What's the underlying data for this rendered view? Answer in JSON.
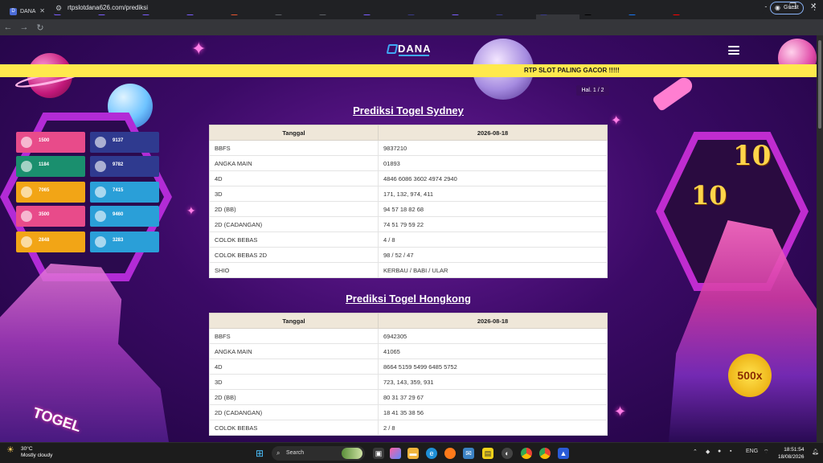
{
  "browser": {
    "tabs": [
      {
        "label": "DANA",
        "fav_color": "#4b6cd8",
        "fav": "D"
      },
      {
        "label": "DANA",
        "fav_color": "#7b5cff",
        "fav": "D"
      },
      {
        "label": "DANA",
        "fav_color": "#7b5cff",
        "fav": "D"
      },
      {
        "label": "DANA",
        "fav_color": "#7b5cff",
        "fav": "D"
      },
      {
        "label": "DANA",
        "fav_color": "#7b5cff",
        "fav": "D"
      },
      {
        "label": "Custo",
        "fav_color": "#e8542f",
        "fav": "C"
      },
      {
        "label": "DANA",
        "fav_color": "#5f6368",
        "fav": "◎"
      },
      {
        "label": "Teleg",
        "fav_color": "#5f6368",
        "fav": "◎"
      },
      {
        "label": "DANA",
        "fav_color": "#7b5cff",
        "fav": "D"
      },
      {
        "label": "RTP D",
        "fav_color": "#3a3a8a",
        "fav": "D"
      },
      {
        "label": "DANA",
        "fav_color": "#7b5cff",
        "fav": "D"
      },
      {
        "label": "Bukti",
        "fav_color": "#3a3a8a",
        "fav": "D"
      },
      {
        "label": "RTP D",
        "fav_color": "#3a3a8a",
        "fav": "D",
        "active": true
      },
      {
        "label": "Dana",
        "fav_color": "#000000",
        "fav": "X"
      },
      {
        "label": "D4n4",
        "fav_color": "#1877f2",
        "fav": "f"
      },
      {
        "label": "DANA",
        "fav_color": "#ff0000",
        "fav": "▶"
      }
    ],
    "url": "rtpslotdana626.com/prediksi",
    "guest_label": "Guest"
  },
  "site": {
    "logo_text": "DANA",
    "marquee_text": "RTP SLOT PALING GACOR !!!!!",
    "pager": "Hal. 1 / 2",
    "togel_text": "TOGEL",
    "badge_500": "500x",
    "slot_symbol": "10"
  },
  "left_tiles": [
    {
      "value": "1500",
      "color": "#e84b8a"
    },
    {
      "value": "9137",
      "color": "#2f3a8f"
    },
    {
      "value": "1184",
      "color": "#1a8f6e"
    },
    {
      "value": "9782",
      "color": "#2f3a8f"
    },
    {
      "value": "7065",
      "color": "#f2a516"
    },
    {
      "value": "7415",
      "color": "#2a9fd8"
    },
    {
      "value": "3500",
      "color": "#e84b8a"
    },
    {
      "value": "9460",
      "color": "#2a9fd8"
    },
    {
      "value": "2848",
      "color": "#f2a516"
    },
    {
      "value": "3283",
      "color": "#2a9fd8"
    }
  ],
  "sydney": {
    "title": "Prediksi Togel Sydney",
    "head_left": "Tanggal",
    "head_right": "2026-08-18",
    "rows": [
      {
        "label": "BBFS",
        "value": "9837210"
      },
      {
        "label": "ANGKA MAIN",
        "value": "01893"
      },
      {
        "label": "4D",
        "value": "4846 6086 3602 4974 2940"
      },
      {
        "label": "3D",
        "value": "171, 132, 974, 411"
      },
      {
        "label": "2D (BB)",
        "value": "94 57 18 82 68"
      },
      {
        "label": "2D (CADANGAN)",
        "value": "74 51 79 59 22"
      },
      {
        "label": "COLOK BEBAS",
        "value": "4 / 8"
      },
      {
        "label": "COLOK BEBAS 2D",
        "value": "98 / 52 / 47"
      },
      {
        "label": "SHIO",
        "value": "KERBAU / BABI / ULAR"
      }
    ]
  },
  "hongkong": {
    "title": "Prediksi Togel Hongkong",
    "head_left": "Tanggal",
    "head_right": "2026-08-18",
    "rows": [
      {
        "label": "BBFS",
        "value": "6942305"
      },
      {
        "label": "ANGKA MAIN",
        "value": "41065"
      },
      {
        "label": "4D",
        "value": "8664 5159 5499 6485 5752"
      },
      {
        "label": "3D",
        "value": "723, 143, 359, 931"
      },
      {
        "label": "2D (BB)",
        "value": "80 31 37 29 67"
      },
      {
        "label": "2D (CADANGAN)",
        "value": "18 41 35 38 56"
      },
      {
        "label": "COLOK BEBAS",
        "value": "2 / 8"
      }
    ]
  },
  "taskbar": {
    "temperature": "30°C",
    "weather": "Mostly cloudy",
    "search_placeholder": "Search",
    "language": "ENG",
    "time": "18:51:54",
    "date": "18/08/2026"
  }
}
